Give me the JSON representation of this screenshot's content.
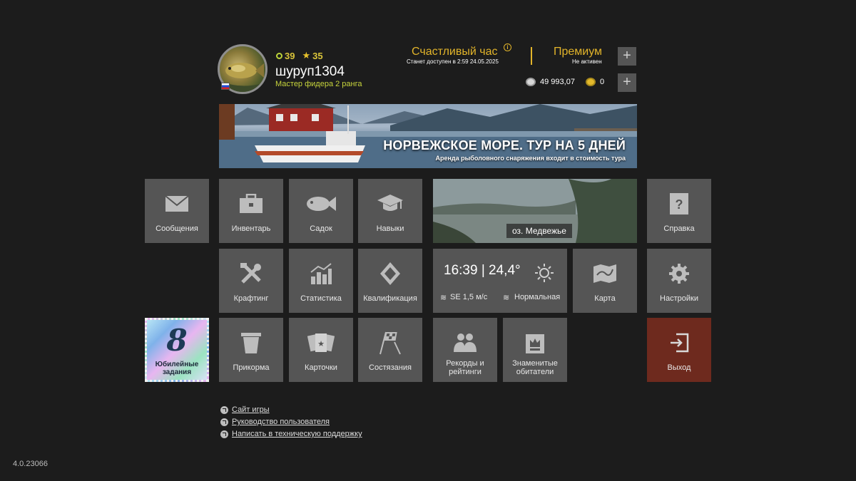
{
  "profile": {
    "level": "39",
    "stars": "35",
    "username": "шуруп1304",
    "rank": "Мастер фидера 2 ранга",
    "flag": "russia-flag-icon"
  },
  "happy_hour": {
    "title": "Счастливый час",
    "subtitle": "Станет доступен в 2:59 24.05.2025"
  },
  "premium": {
    "title": "Премиум",
    "status": "Не активен"
  },
  "currency": {
    "silver": "49 993,07",
    "gold": "0"
  },
  "banner": {
    "title": "НОРВЕЖСКОЕ МОРЕ. ТУР НА 5 ДНЕЙ",
    "subtitle": "Аренда рыболовного снаряжения входит в стоимость тура"
  },
  "tiles": {
    "messages": "Сообщения",
    "inventory": "Инвентарь",
    "keepnet": "Садок",
    "skills": "Навыки",
    "help": "Справка",
    "crafting": "Крафтинг",
    "statistics": "Статистика",
    "qualification": "Квалификация",
    "map": "Карта",
    "settings": "Настройки",
    "groundbait": "Прикорма",
    "cards": "Карточки",
    "competitions": "Состязания",
    "records_1": "Рекорды и",
    "records_2": "рейтинги",
    "famous_1": "Знаменитые",
    "famous_2": "обитатели",
    "exit": "Выход"
  },
  "location": {
    "name": "оз. Медвежье"
  },
  "weather": {
    "time_temp": "16:39 | 24,4°",
    "wind": "SE  1,5 м/с",
    "pressure": "Нормальная"
  },
  "jubilee": {
    "number": "8",
    "line1": "Юбилейные",
    "line2": "задания"
  },
  "links": [
    "Сайт игры",
    "Руководство пользователя",
    "Написать в техническую поддержку"
  ],
  "version": "4.0.23066",
  "colors": {
    "background": "#1c1c1c",
    "tile": "#555555",
    "exit_tile": "#6e2a1e",
    "accent_gold": "#e2b42a",
    "rank_green": "#c7d43c"
  }
}
